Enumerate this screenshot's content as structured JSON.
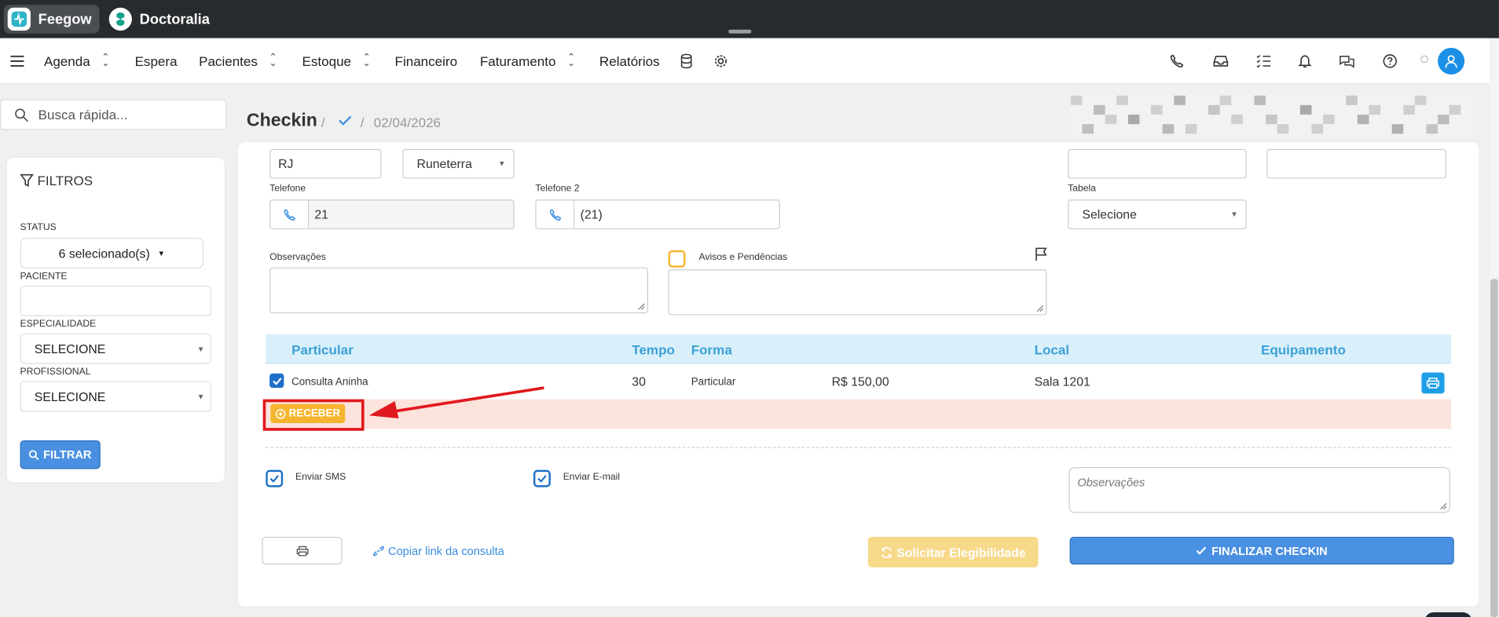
{
  "topbar": {
    "apps": [
      {
        "label": "Feegow",
        "active": true
      },
      {
        "label": "Doctoralia",
        "active": false
      }
    ]
  },
  "nav": {
    "items": [
      {
        "label": "Agenda",
        "dropdown": true
      },
      {
        "label": "Espera",
        "dropdown": false
      },
      {
        "label": "Pacientes",
        "dropdown": true
      },
      {
        "label": "Estoque",
        "dropdown": true
      },
      {
        "label": "Financeiro",
        "dropdown": false
      },
      {
        "label": "Faturamento",
        "dropdown": true
      },
      {
        "label": "Relatórios",
        "dropdown": false
      }
    ],
    "right_icons": [
      "phone-icon",
      "inbox-icon",
      "checklist-icon",
      "bell-icon",
      "chat-icon",
      "help-icon"
    ]
  },
  "sidebar": {
    "search_placeholder": "Busca rápida...",
    "filters_title": "FILTROS",
    "status_label": "STATUS",
    "status_value": "6 selecionado(s)",
    "paciente_label": "PACIENTE",
    "paciente_value": "",
    "especialidade_label": "ESPECIALIDADE",
    "especialidade_value": "SELECIONE",
    "profissional_label": "PROFISSIONAL",
    "profissional_value": "SELECIONE",
    "filter_button": "FILTRAR"
  },
  "header": {
    "title": "Checkin",
    "separator": "/",
    "date": "02/04/2026"
  },
  "form": {
    "estado_value": "RJ",
    "cidade_value": "Runeterra",
    "telefone_label": "Telefone",
    "telefone_value": "21",
    "telefone2_label": "Telefone 2",
    "telefone2_value": "(21)",
    "tabela_label": "Tabela",
    "tabela_value": "Selecione",
    "observacoes_label": "Observações",
    "avisos_label": "Avisos e Pendências"
  },
  "procedures": {
    "headers": {
      "particular": "Particular",
      "tempo": "Tempo",
      "forma": "Forma",
      "local": "Local",
      "equipamento": "Equipamento"
    },
    "rows": [
      {
        "checked": true,
        "name": "Consulta Aninha",
        "tempo": "30",
        "forma": "Particular",
        "valor": "R$ 150,00",
        "local": "Sala 1201"
      }
    ],
    "receber_button": "RECEBER"
  },
  "notifications": {
    "sms_label": "Enviar SMS",
    "sms_checked": true,
    "email_label": "Enviar E-mail",
    "email_checked": true,
    "obs_placeholder": "Observações"
  },
  "actions": {
    "copy_link": "Copiar link da consulta",
    "eligibility_button": "Solicitar Elegibilidade",
    "finalize_button": "FINALIZAR CHECKIN"
  },
  "colors": {
    "accent": "#4a90e2",
    "warning": "#f5b52e",
    "highlight": "#e0191e",
    "table_head": "#d9f0fb"
  }
}
